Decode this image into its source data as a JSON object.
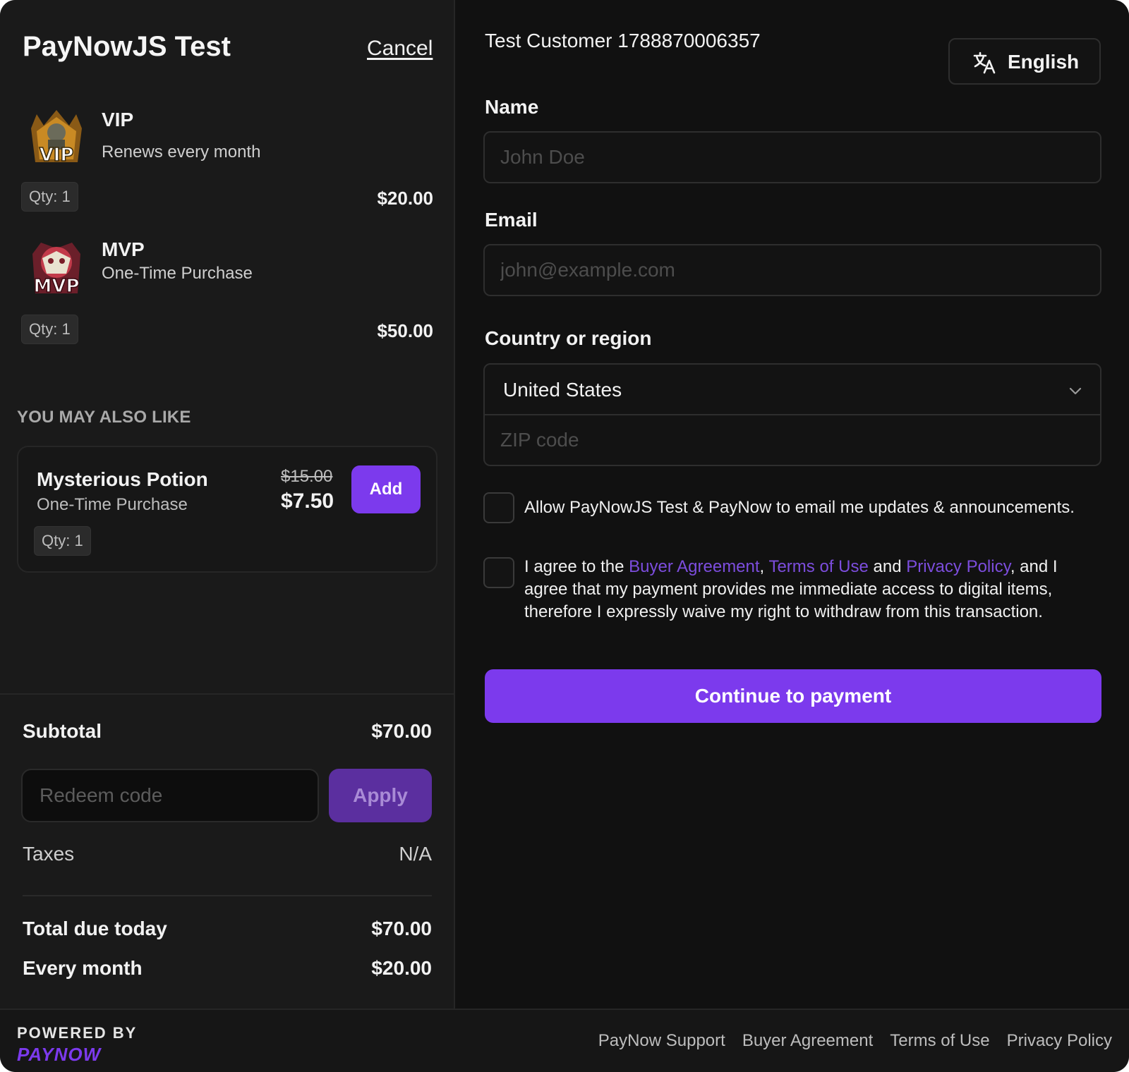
{
  "store": {
    "title": "PayNowJS Test",
    "cancel_label": "Cancel"
  },
  "cart": {
    "items": [
      {
        "name": "VIP",
        "subtitle": "Renews every month",
        "qty": "Qty: 1",
        "price": "$20.00",
        "icon": "vip-badge-icon"
      },
      {
        "name": "MVP",
        "subtitle": "One-Time Purchase",
        "qty": "Qty: 1",
        "price": "$50.00",
        "icon": "mvp-badge-icon"
      }
    ]
  },
  "upsell": {
    "heading": "YOU MAY ALSO LIKE",
    "item": {
      "name": "Mysterious Potion",
      "subtitle": "One-Time Purchase",
      "old_price": "$15.00",
      "new_price": "$7.50",
      "qty": "Qty: 1",
      "add_label": "Add"
    }
  },
  "summary": {
    "subtotal_label": "Subtotal",
    "subtotal_value": "$70.00",
    "redeem_placeholder": "Redeem code",
    "apply_label": "Apply",
    "taxes_label": "Taxes",
    "taxes_value": "N/A",
    "total_label": "Total due today",
    "total_value": "$70.00",
    "recurring_label": "Every month",
    "recurring_value": "$20.00"
  },
  "checkout": {
    "customer": "Test Customer 1788870006357",
    "language": "English",
    "name_label": "Name",
    "name_placeholder": "John Doe",
    "email_label": "Email",
    "email_placeholder": "john@example.com",
    "country_label": "Country or region",
    "country_value": "United States",
    "zip_placeholder": "ZIP code",
    "consent_updates": "Allow PayNowJS Test & PayNow to email me updates & announcements.",
    "agree": {
      "prefix": "I agree to the ",
      "buyer_agreement": "Buyer Agreement",
      "comma": ", ",
      "terms": "Terms of Use",
      "and": " and ",
      "privacy": "Privacy Policy",
      "suffix": ", and I agree that my payment provides me immediate access to digital items, therefore I expressly waive my right to withdraw from this transaction."
    },
    "continue_label": "Continue to payment"
  },
  "footer": {
    "powered_by": "POWERED BY",
    "brand": "PAYNOW",
    "links": [
      "PayNow Support",
      "Buyer Agreement",
      "Terms of Use",
      "Privacy Policy"
    ]
  },
  "colors": {
    "accent": "#7c3aed",
    "link": "#7c4ddd",
    "background": "#111111",
    "panel": "#1a1a1a"
  }
}
